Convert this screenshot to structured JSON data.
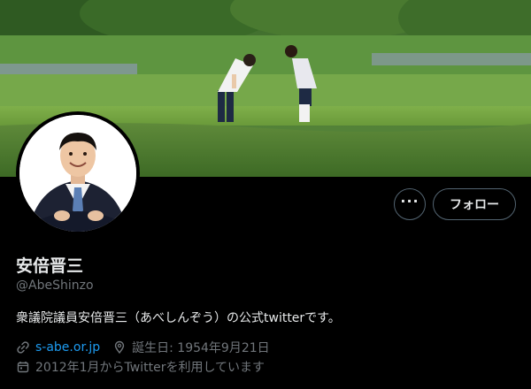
{
  "profile": {
    "name": "安倍晋三",
    "handle": "@AbeShinzo",
    "bio": "衆議院議員安倍晋三（あべしんぞう）の公式twitterです。",
    "website": "s-abe.or.jp",
    "birthday": "誕生日: 1954年9月21日",
    "joined": "2012年1月からTwitterを利用しています"
  },
  "actions": {
    "more_label": "···",
    "follow_label": "フォロー"
  },
  "icons": {
    "link": "link-icon",
    "birthday": "location-pin-icon",
    "joined": "calendar-icon",
    "more": "more-options-icon"
  },
  "colors": {
    "background": "#000000",
    "text": "#e7e9ea",
    "muted": "#71767b",
    "link": "#1d9bf0",
    "border": "#536471"
  }
}
